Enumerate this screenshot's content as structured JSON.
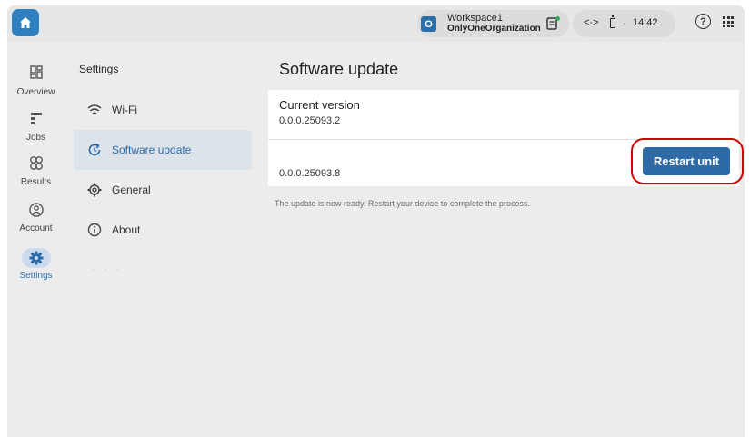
{
  "topbar": {
    "home_icon": "home-icon",
    "workspace": {
      "badge": "O",
      "name": "Workspace1",
      "organization": "OnlyOneOrganization",
      "icon": "clipboard-status-icon"
    },
    "status": {
      "network_icon": "network-arrows-icon",
      "network_glyph": "<·>",
      "battery_icon": "battery-icon",
      "time": "14:42"
    },
    "help_icon": "help-circle-icon",
    "help_glyph": "?",
    "apps_icon": "apps-grid-icon"
  },
  "rail": {
    "items": [
      {
        "label": "Overview",
        "icon": "dashboard-icon"
      },
      {
        "label": "Jobs",
        "icon": "jobs-list-icon"
      },
      {
        "label": "Results",
        "icon": "results-icon"
      },
      {
        "label": "Account",
        "icon": "account-icon"
      },
      {
        "label": "Settings",
        "icon": "gear-icon"
      }
    ]
  },
  "settings_nav": {
    "title": "Settings",
    "items": [
      {
        "label": "Wi-Fi",
        "icon": "wifi-icon"
      },
      {
        "label": "Software update",
        "icon": "update-icon"
      },
      {
        "label": "General",
        "icon": "settings-cog-icon"
      },
      {
        "label": "About",
        "icon": "info-icon"
      }
    ],
    "faded": "· ·  ·"
  },
  "main": {
    "title": "Software update",
    "current_version_label": "Current version",
    "current_version": "0.0.0.25093.2",
    "new_version": "0.0.0.25093.8",
    "restart_label": "Restart unit",
    "note": "The update is now ready. Restart your device to complete the process."
  },
  "colors": {
    "accent": "#2d6aa6",
    "highlight": "#d10000",
    "active_nav": "#dde3ea"
  }
}
